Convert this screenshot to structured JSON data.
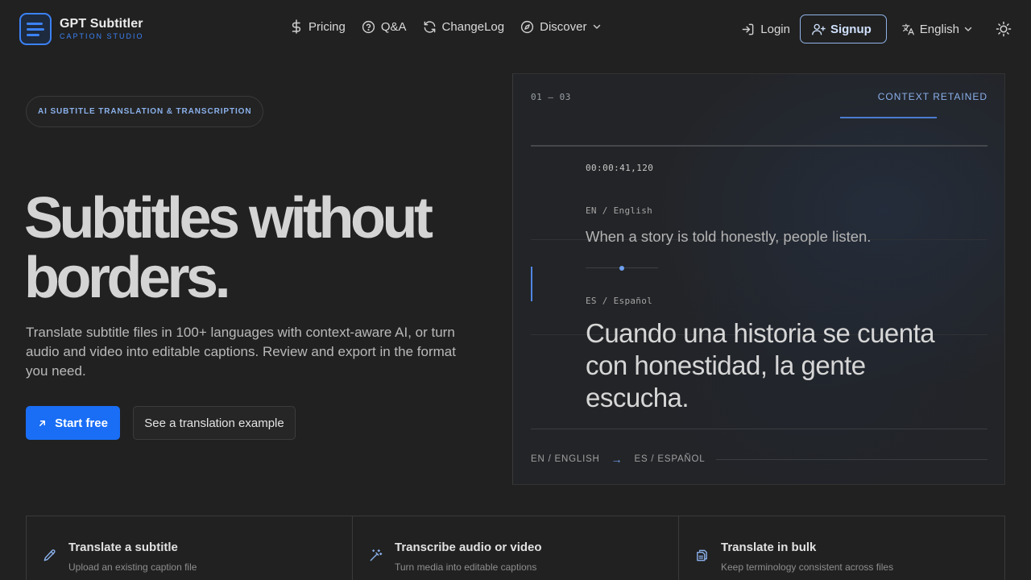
{
  "brand": {
    "name": "GPT Subtitler",
    "tagline": "CAPTION STUDIO"
  },
  "nav": {
    "pricing": "Pricing",
    "qa": "Q&A",
    "changelog": "ChangeLog",
    "discover": "Discover"
  },
  "account": {
    "login": "Login",
    "signup": "Signup",
    "language": "English"
  },
  "hero": {
    "badge": "AI SUBTITLE TRANSLATION & TRANSCRIPTION",
    "title_line1": "Subtitles without",
    "title_line2": "borders.",
    "description": "Translate subtitle files in 100+ languages with context-aware AI, or turn audio and video into editable captions. Review and export in the format you need.",
    "primary_cta": "Start free",
    "secondary_cta": "See a translation example"
  },
  "preview": {
    "counter": "01 — 03",
    "context": "CONTEXT RETAINED",
    "timestamp": "00:00:41,120",
    "source_label": "EN / English",
    "source_text": "When a story is told honestly, people listen.",
    "target_label": "ES / Español",
    "target_text": "Cuando una historia se cuenta con honestidad, la gente escucha.",
    "footer_from": "EN / ENGLISH",
    "footer_arrow": "→",
    "footer_to": "ES / ESPAÑOL"
  },
  "features": [
    {
      "title": "Translate a subtitle",
      "subtitle": "Upload an existing caption file",
      "icon": "pencil-icon"
    },
    {
      "title": "Transcribe audio or video",
      "subtitle": "Turn media into editable captions",
      "icon": "wand-icon"
    },
    {
      "title": "Translate in bulk",
      "subtitle": "Keep terminology consistent across files",
      "icon": "files-icon"
    }
  ],
  "colors": {
    "accent": "#1a6ef5",
    "accent_light": "#8ab0ea",
    "background": "#212121"
  }
}
